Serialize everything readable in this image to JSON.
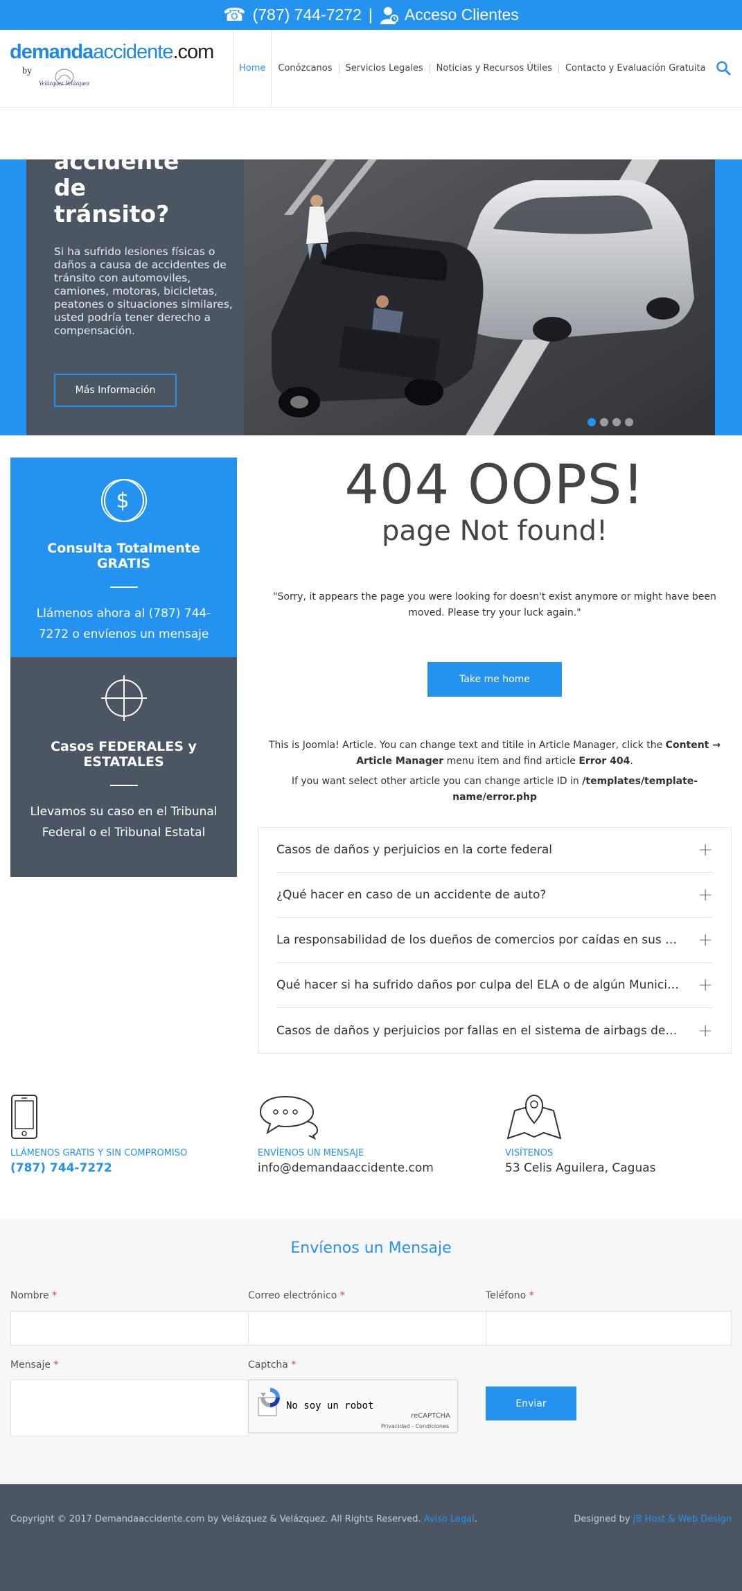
{
  "topbar": {
    "phone": "(787) 744-7272",
    "separator": "|",
    "clients_label": "Acceso Clientes"
  },
  "logo": {
    "part1": "demanda",
    "part2": "accidente",
    "part3": ".com",
    "by": "by",
    "firm": "Velázquez Velázquez"
  },
  "nav": {
    "items": [
      "Home",
      "Conózcanos",
      "Servicios Legales",
      "Noticias y Recursos Útiles",
      "Contacto y Evaluación Gratuita"
    ]
  },
  "hero": {
    "title_lines": [
      "accidente",
      "de",
      "tránsito?"
    ],
    "text": "Si ha sufrido lesiones físicas o daños a causa de accidentes de tránsito con automoviles, camiones, motoras, bicicletas, peatones o situaciones similares, usted podría tener derecho a compensación.",
    "button": "Más Información"
  },
  "side_boxes": {
    "consulta": {
      "title": "Consulta Totalmente GRATIS",
      "text": "Llámenos ahora al (787) 744-7272 o envíenos un mensaje"
    },
    "casos": {
      "title": "Casos FEDERALES y ESTATALES",
      "text": "Llevamos su caso en el Tribunal Federal o el Tribunal Estatal"
    }
  },
  "error": {
    "big": "404 OOPS!",
    "sub": "page Not found!",
    "message": "\"Sorry, it appears the page you were looking for doesn't exist anymore or might have been moved. Please try your luck again.\"",
    "button": "Take me home"
  },
  "article_note": {
    "line1_pre": "This is Joomla! Article. You can change text and titile in Article Manager, click the ",
    "line1_bold": "Content → Article Manager",
    "line1_mid": " menu item and find article ",
    "line1_bold2": "Error 404",
    "line1_end": ".",
    "line2_pre": "If you want select other article you can change article ID in ",
    "line2_bold": "/templates/template-name/error.php"
  },
  "accordion": {
    "items": [
      "Casos de daños y perjuicios en la corte federal",
      "¿Qué hacer en caso de un accidente de auto?",
      "La responsabilidad de los dueños de comercios por caídas en sus …",
      "Qué hacer si ha sufrido daños por culpa del ELA o de algún Munici…",
      "Casos de daños y perjuicios por fallas en el sistema de airbags de…"
    ]
  },
  "contact_info": {
    "call_label": "LLÁMENOS GRATIS Y SIN COMPROMISO",
    "call_value": "(787) 744-7272",
    "msg_label": "ENVÍENOS UN MENSAJE",
    "msg_value": "info@demandaaccidente.com",
    "visit_label": "VISÍTENOS",
    "visit_value": "53 Celis Aguilera, Caguas"
  },
  "form": {
    "title": "Envíenos un Mensaje",
    "name_label": "Nombre",
    "email_label": "Correo electrónico",
    "phone_label": "Teléfono",
    "message_label": "Mensaje",
    "captcha_label": "Captcha",
    "required_mark": "*",
    "captcha_text": "No soy un robot",
    "captcha_brand": "reCAPTCHA",
    "captcha_terms": "Privacidad - Condiciones",
    "send": "Enviar"
  },
  "footer": {
    "copyright": "Copyright © 2017 Demandaaccidente.com by Velázquez & Velázquez. All Rights Reserved. ",
    "legal_link": "Aviso Legal",
    "legal_end": ".",
    "designed_by": "Designed by ",
    "designer_link": "JB Host & Web Design"
  },
  "colors": {
    "accent": "#2393ef",
    "dark_panel": "#4c5662",
    "form_bg": "#f7f7f7"
  }
}
